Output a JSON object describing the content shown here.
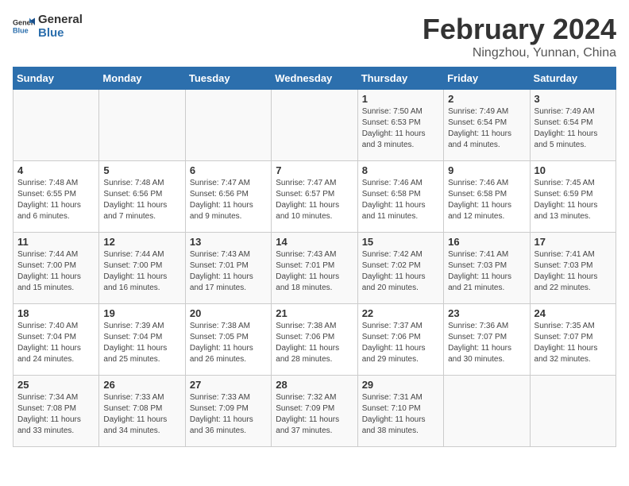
{
  "header": {
    "logo_general": "General",
    "logo_blue": "Blue",
    "month": "February 2024",
    "location": "Ningzhou, Yunnan, China"
  },
  "weekdays": [
    "Sunday",
    "Monday",
    "Tuesday",
    "Wednesday",
    "Thursday",
    "Friday",
    "Saturday"
  ],
  "weeks": [
    [
      {
        "day": "",
        "info": ""
      },
      {
        "day": "",
        "info": ""
      },
      {
        "day": "",
        "info": ""
      },
      {
        "day": "",
        "info": ""
      },
      {
        "day": "1",
        "info": "Sunrise: 7:50 AM\nSunset: 6:53 PM\nDaylight: 11 hours\nand 3 minutes."
      },
      {
        "day": "2",
        "info": "Sunrise: 7:49 AM\nSunset: 6:54 PM\nDaylight: 11 hours\nand 4 minutes."
      },
      {
        "day": "3",
        "info": "Sunrise: 7:49 AM\nSunset: 6:54 PM\nDaylight: 11 hours\nand 5 minutes."
      }
    ],
    [
      {
        "day": "4",
        "info": "Sunrise: 7:48 AM\nSunset: 6:55 PM\nDaylight: 11 hours\nand 6 minutes."
      },
      {
        "day": "5",
        "info": "Sunrise: 7:48 AM\nSunset: 6:56 PM\nDaylight: 11 hours\nand 7 minutes."
      },
      {
        "day": "6",
        "info": "Sunrise: 7:47 AM\nSunset: 6:56 PM\nDaylight: 11 hours\nand 9 minutes."
      },
      {
        "day": "7",
        "info": "Sunrise: 7:47 AM\nSunset: 6:57 PM\nDaylight: 11 hours\nand 10 minutes."
      },
      {
        "day": "8",
        "info": "Sunrise: 7:46 AM\nSunset: 6:58 PM\nDaylight: 11 hours\nand 11 minutes."
      },
      {
        "day": "9",
        "info": "Sunrise: 7:46 AM\nSunset: 6:58 PM\nDaylight: 11 hours\nand 12 minutes."
      },
      {
        "day": "10",
        "info": "Sunrise: 7:45 AM\nSunset: 6:59 PM\nDaylight: 11 hours\nand 13 minutes."
      }
    ],
    [
      {
        "day": "11",
        "info": "Sunrise: 7:44 AM\nSunset: 7:00 PM\nDaylight: 11 hours\nand 15 minutes."
      },
      {
        "day": "12",
        "info": "Sunrise: 7:44 AM\nSunset: 7:00 PM\nDaylight: 11 hours\nand 16 minutes."
      },
      {
        "day": "13",
        "info": "Sunrise: 7:43 AM\nSunset: 7:01 PM\nDaylight: 11 hours\nand 17 minutes."
      },
      {
        "day": "14",
        "info": "Sunrise: 7:43 AM\nSunset: 7:01 PM\nDaylight: 11 hours\nand 18 minutes."
      },
      {
        "day": "15",
        "info": "Sunrise: 7:42 AM\nSunset: 7:02 PM\nDaylight: 11 hours\nand 20 minutes."
      },
      {
        "day": "16",
        "info": "Sunrise: 7:41 AM\nSunset: 7:03 PM\nDaylight: 11 hours\nand 21 minutes."
      },
      {
        "day": "17",
        "info": "Sunrise: 7:41 AM\nSunset: 7:03 PM\nDaylight: 11 hours\nand 22 minutes."
      }
    ],
    [
      {
        "day": "18",
        "info": "Sunrise: 7:40 AM\nSunset: 7:04 PM\nDaylight: 11 hours\nand 24 minutes."
      },
      {
        "day": "19",
        "info": "Sunrise: 7:39 AM\nSunset: 7:04 PM\nDaylight: 11 hours\nand 25 minutes."
      },
      {
        "day": "20",
        "info": "Sunrise: 7:38 AM\nSunset: 7:05 PM\nDaylight: 11 hours\nand 26 minutes."
      },
      {
        "day": "21",
        "info": "Sunrise: 7:38 AM\nSunset: 7:06 PM\nDaylight: 11 hours\nand 28 minutes."
      },
      {
        "day": "22",
        "info": "Sunrise: 7:37 AM\nSunset: 7:06 PM\nDaylight: 11 hours\nand 29 minutes."
      },
      {
        "day": "23",
        "info": "Sunrise: 7:36 AM\nSunset: 7:07 PM\nDaylight: 11 hours\nand 30 minutes."
      },
      {
        "day": "24",
        "info": "Sunrise: 7:35 AM\nSunset: 7:07 PM\nDaylight: 11 hours\nand 32 minutes."
      }
    ],
    [
      {
        "day": "25",
        "info": "Sunrise: 7:34 AM\nSunset: 7:08 PM\nDaylight: 11 hours\nand 33 minutes."
      },
      {
        "day": "26",
        "info": "Sunrise: 7:33 AM\nSunset: 7:08 PM\nDaylight: 11 hours\nand 34 minutes."
      },
      {
        "day": "27",
        "info": "Sunrise: 7:33 AM\nSunset: 7:09 PM\nDaylight: 11 hours\nand 36 minutes."
      },
      {
        "day": "28",
        "info": "Sunrise: 7:32 AM\nSunset: 7:09 PM\nDaylight: 11 hours\nand 37 minutes."
      },
      {
        "day": "29",
        "info": "Sunrise: 7:31 AM\nSunset: 7:10 PM\nDaylight: 11 hours\nand 38 minutes."
      },
      {
        "day": "",
        "info": ""
      },
      {
        "day": "",
        "info": ""
      }
    ]
  ]
}
